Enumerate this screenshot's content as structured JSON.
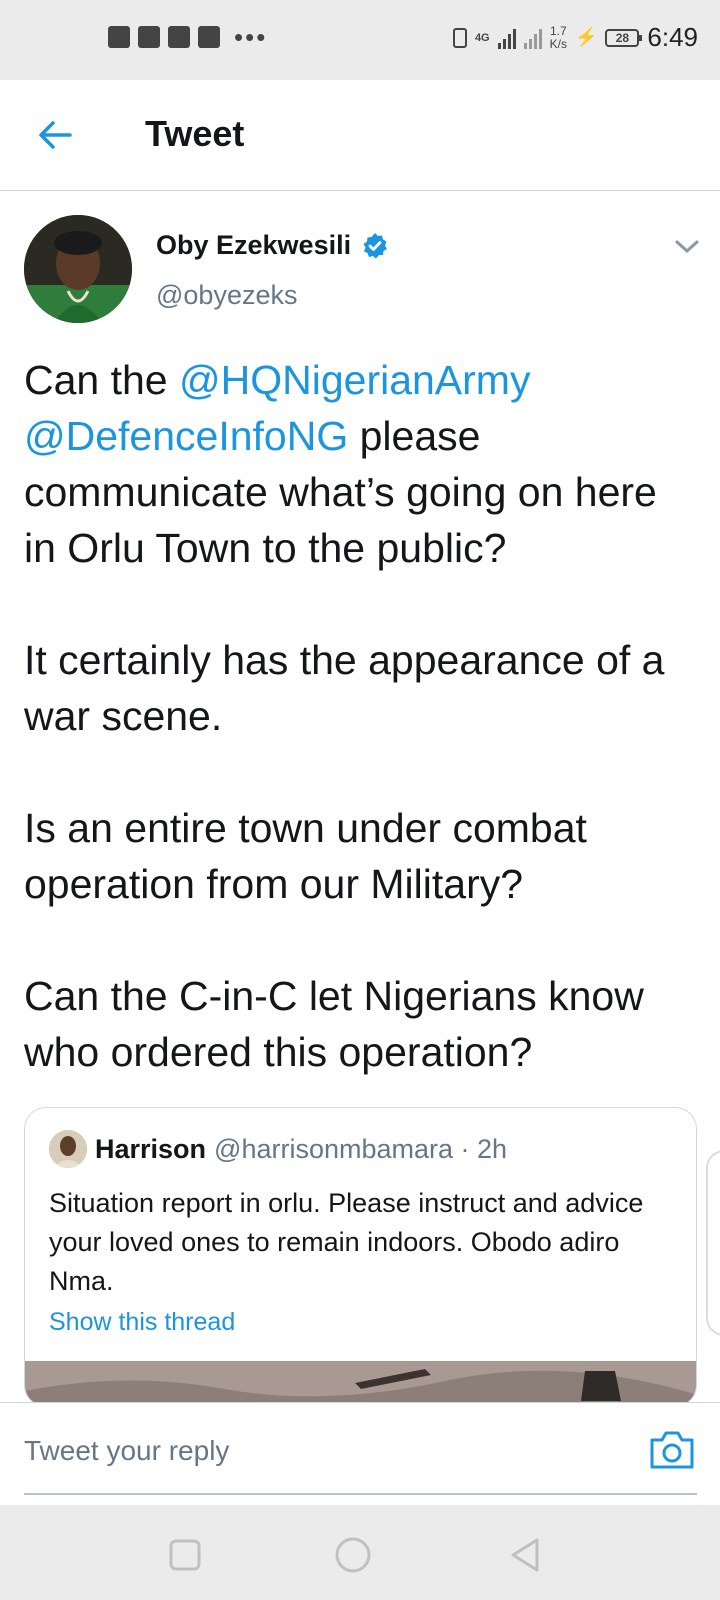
{
  "status_bar": {
    "time": "6:49",
    "battery": "28",
    "net_speed_value": "1.7",
    "net_speed_unit": "K/s",
    "network_type": "4G"
  },
  "header": {
    "title": "Tweet"
  },
  "tweet": {
    "author_name": "Oby Ezekwesili",
    "author_handle": "@obyezeks",
    "p1_prefix": "Can the ",
    "mention_1": "@HQNigerianArmy",
    "mention_2": "@DefenceInfoNG",
    "p1_suffix": " please communicate what’s going on here in Orlu Town to the public?",
    "p2": "It certainly has the appearance of a war scene.",
    "p3": "Is an entire town under combat operation from our Military?",
    "p4": "Can the C-in-C let Nigerians know who ordered this operation?"
  },
  "quoted_tweet": {
    "name": "Harrison",
    "handle_time": "@harrisonmbamara · 2h",
    "text": "Situation report in orlu. Please instruct and advice your loved ones to remain indoors. Obodo adiro Nma.",
    "show_thread": "Show this thread"
  },
  "reply": {
    "placeholder": "Tweet your reply"
  },
  "colors": {
    "accent": "#1b95e0",
    "text": "#14171a",
    "secondary": "#657786"
  }
}
